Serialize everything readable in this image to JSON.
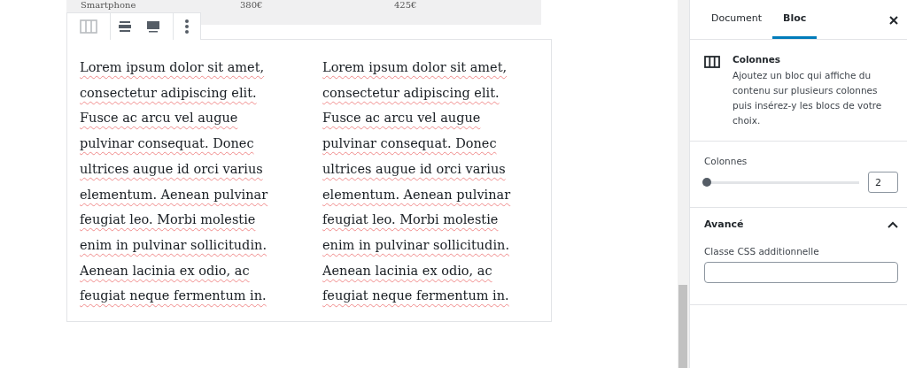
{
  "table_row": [
    "Smartphone",
    "380€",
    "425€"
  ],
  "block_toolbar": {
    "buttons": [
      {
        "kind": "columns"
      },
      {
        "kind": "align-wide"
      },
      {
        "kind": "align-full"
      },
      {
        "kind": "more"
      }
    ]
  },
  "columns": [
    {
      "text": "Lorem ipsum dolor sit amet, consectetur adipiscing elit. Fusce ac arcu vel augue pulvinar consequat. Donec ultrices augue id orci varius elementum. Aenean pulvinar feugiat leo. Morbi molestie enim in pulvinar sollicitudin. Aenean lacinia ex odio, ac feugiat neque fermentum in."
    },
    {
      "text": "Lorem ipsum dolor sit amet, consectetur adipiscing elit. Fusce ac arcu vel augue pulvinar consequat. Donec ultrices augue id orci varius elementum. Aenean pulvinar feugiat leo. Morbi molestie enim in pulvinar sollicitudin. Aenean lacinia ex odio, ac feugiat neque fermentum in."
    }
  ],
  "sidebar": {
    "tabs": [
      {
        "label": "Document",
        "selected": false
      },
      {
        "label": "Bloc",
        "selected": true
      }
    ],
    "block_card": {
      "title": "Colonnes",
      "description": "Ajoutez un bloc qui affiche du contenu sur plusieurs colonnes puis insérez-y les blocs de votre choix."
    },
    "columns_setting": {
      "label": "Colonnes",
      "level": 0,
      "value": "2"
    },
    "advanced": {
      "title": "Avancé",
      "expanded": true,
      "field_label": "Classe CSS additionnelle"
    }
  }
}
